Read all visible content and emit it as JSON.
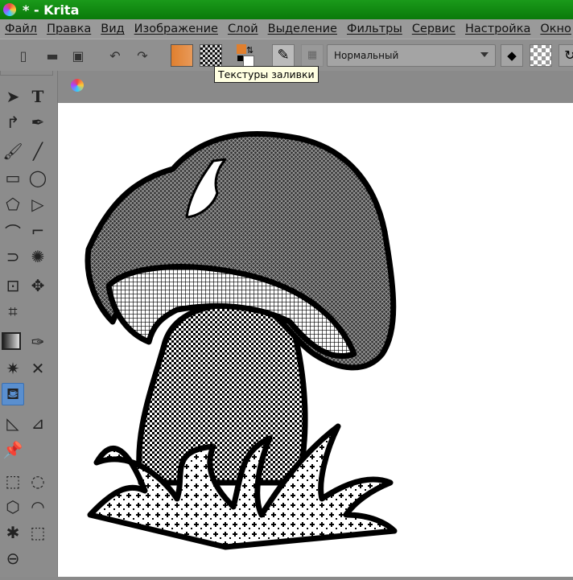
{
  "window": {
    "title": "* - Krita"
  },
  "menu": [
    "Файл",
    "Правка",
    "Вид",
    "Изображение",
    "Слой",
    "Выделение",
    "Фильтры",
    "Сервис",
    "Настройка",
    "Окно"
  ],
  "toolbar": {
    "blend_mode": "Нормальный",
    "tooltip": "Текстуры заливки",
    "foreground_color": "#e07f2e",
    "background_color": "#ffffff",
    "icons": [
      "new-document-icon",
      "open-icon",
      "save-icon",
      "undo-icon",
      "redo-icon",
      "gradient-icon",
      "pattern-icon",
      "color-swap-icon",
      "brush-preset-icon",
      "mirror-icon",
      "eraser-icon",
      "alpha-lock-icon",
      "wrap-icon"
    ]
  },
  "toolbox": {
    "active_tool": "fill-tool"
  },
  "colors": {
    "titlebar": "#0a8a0a",
    "selection": "#5a8fcf"
  }
}
